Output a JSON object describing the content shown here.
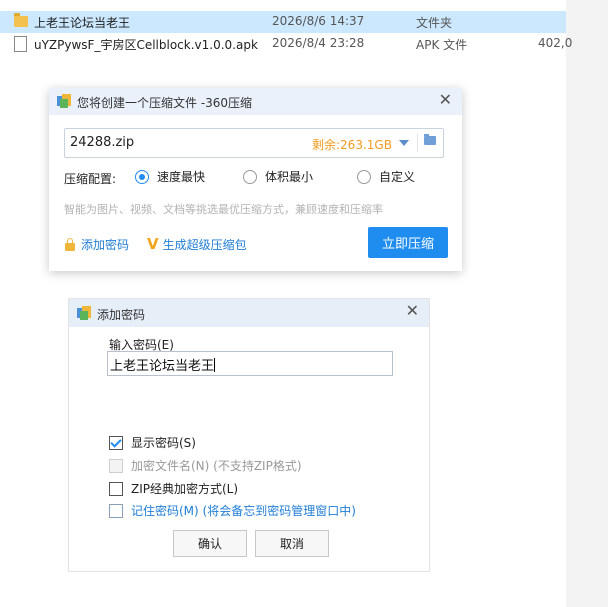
{
  "files": [
    {
      "name": "上老王论坛当老王",
      "date": "2026/8/6 14:37",
      "type": "文件夹",
      "size": "",
      "icon": "folder-icon",
      "selected": true
    },
    {
      "name": "uYZPywsF_宇房区Cellblock.v1.0.0.apk",
      "date": "2026/8/4 23:28",
      "type": "APK 文件",
      "size": "402,0",
      "icon": "file-icon",
      "selected": false
    }
  ],
  "compress_dialog": {
    "title": "您将创建一个压缩文件 -360压缩",
    "filename": "24288.zip",
    "free_space": "剩余:263.1GB",
    "config_label": "压缩配置:",
    "options": [
      "速度最快",
      "体积最小",
      "自定义"
    ],
    "selected_option": "速度最快",
    "hint": "智能为图片、视频、文档等挑选最优压缩方式，兼顾速度和压缩率",
    "add_password": "添加密码",
    "sfx": "生成超级压缩包",
    "compress_button": "立即压缩",
    "accent_color": "#1f8cf0",
    "space_color": "#f29b1f"
  },
  "password_dialog": {
    "title": "添加密码",
    "input_label": "输入密码(E)",
    "password_value": "上老王论坛当老王",
    "checkboxes": [
      {
        "label": "显示密码(S)",
        "checked": true,
        "disabled": false
      },
      {
        "label": "加密文件名(N) (不支持ZIP格式)",
        "checked": false,
        "disabled": true
      },
      {
        "label": "ZIP经典加密方式(L)",
        "checked": false,
        "disabled": false
      },
      {
        "label": "记住密码(M) (将会备忘到密码管理窗口中)",
        "checked": false,
        "disabled": false
      }
    ],
    "ok_button": "确认",
    "cancel_button": "取消"
  }
}
